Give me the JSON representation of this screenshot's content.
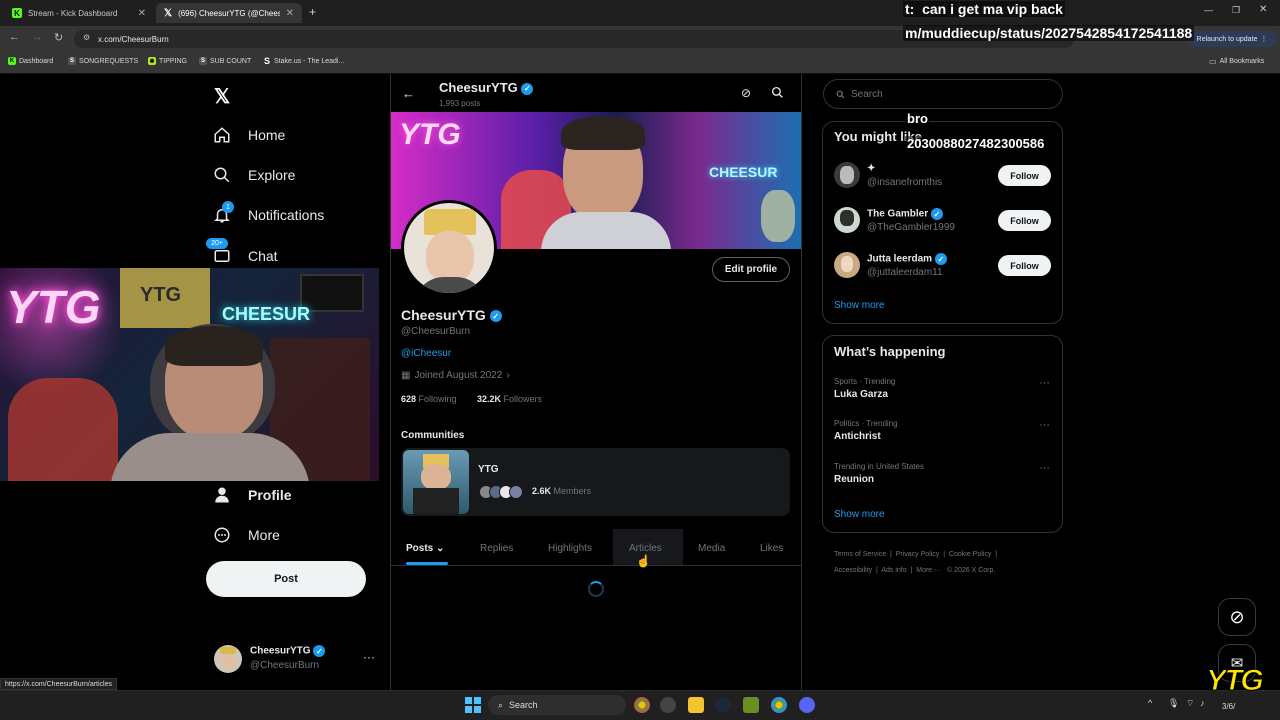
{
  "browser": {
    "tabs": [
      {
        "title": "Stream - Kick Dashboard"
      },
      {
        "title": "(696) CheesurYTG (@CheesurBu"
      }
    ],
    "url": "x.com/CheesurBurn",
    "relaunch_label": "Relaunch to update",
    "bookmarks": [
      "Dashboard",
      "SONGREQUESTS",
      "TIPPING",
      "SUB COUNT",
      "Stake.us - The Leadi..."
    ],
    "all_bookmarks": "All Bookmarks",
    "status_url": "https://x.com/CheesurBurn/articles"
  },
  "overlay": {
    "line1_prefix": "t:",
    "line1": "can i get ma vip back",
    "line2": "m/muddiecup/status/2027542854172541188",
    "bro": "bro",
    "number": "2030088027482300586"
  },
  "nav": {
    "items": [
      {
        "label": "Home",
        "icon": "home-icon"
      },
      {
        "label": "Explore",
        "icon": "search-icon"
      },
      {
        "label": "Notifications",
        "icon": "bell-icon",
        "badge": "1"
      },
      {
        "label": "Chat",
        "icon": "chat-icon",
        "badge": "20+"
      },
      {
        "label": "Profile",
        "icon": "person-icon"
      },
      {
        "label": "More",
        "icon": "more-circle-icon"
      }
    ],
    "post_label": "Post",
    "account_name": "CheesurYTG",
    "account_handle": "@CheesurBurn"
  },
  "profile": {
    "header_name": "CheesurYTG",
    "post_count": "1,993 posts",
    "banner_text_left": "YTG",
    "banner_text_right": "CHEESUR",
    "edit_label": "Edit profile",
    "name": "CheesurYTG",
    "handle": "@CheesurBurn",
    "bio_link": "@iCheesur",
    "joined": "Joined August 2022",
    "following_count": "628",
    "following_label": "Following",
    "followers_count": "32.2K",
    "followers_label": "Followers",
    "communities_title": "Communities",
    "community_name": "YTG",
    "community_members_count": "2.6K",
    "community_members_label": "Members",
    "tabs": [
      "Posts",
      "Replies",
      "Highlights",
      "Articles",
      "Media",
      "Likes"
    ]
  },
  "right": {
    "search_placeholder": "Search",
    "you_might_like": "You might like",
    "suggestions": [
      {
        "name": "✦",
        "handle": "@insanefromthis",
        "follow": "Follow"
      },
      {
        "name": "The Gambler",
        "handle": "@TheGambler1999",
        "follow": "Follow"
      },
      {
        "name": "Jutta leerdam",
        "handle": "@juttaleerdam11",
        "follow": "Follow"
      }
    ],
    "show_more": "Show more",
    "happening_title": "What’s happening",
    "trends": [
      {
        "meta": "Sports · Trending",
        "name": "Luka Garza"
      },
      {
        "meta": "Politics · Trending",
        "name": "Antichrist"
      },
      {
        "meta": "Trending in United States",
        "name": "Reunion"
      }
    ],
    "show_more_2": "Show more",
    "footer": [
      "Terms of Service",
      "Privacy Policy",
      "Cookie Policy",
      "Accessibility",
      "Ads info",
      "More ···",
      "© 2026 X Corp."
    ]
  },
  "webcam": {
    "sign_left": "YTG",
    "sign_mid": "YTG",
    "sign_right": "CHEESUR"
  },
  "taskbar": {
    "search_label": "Search",
    "corner_logo": "YTG",
    "date": "3/6/"
  }
}
